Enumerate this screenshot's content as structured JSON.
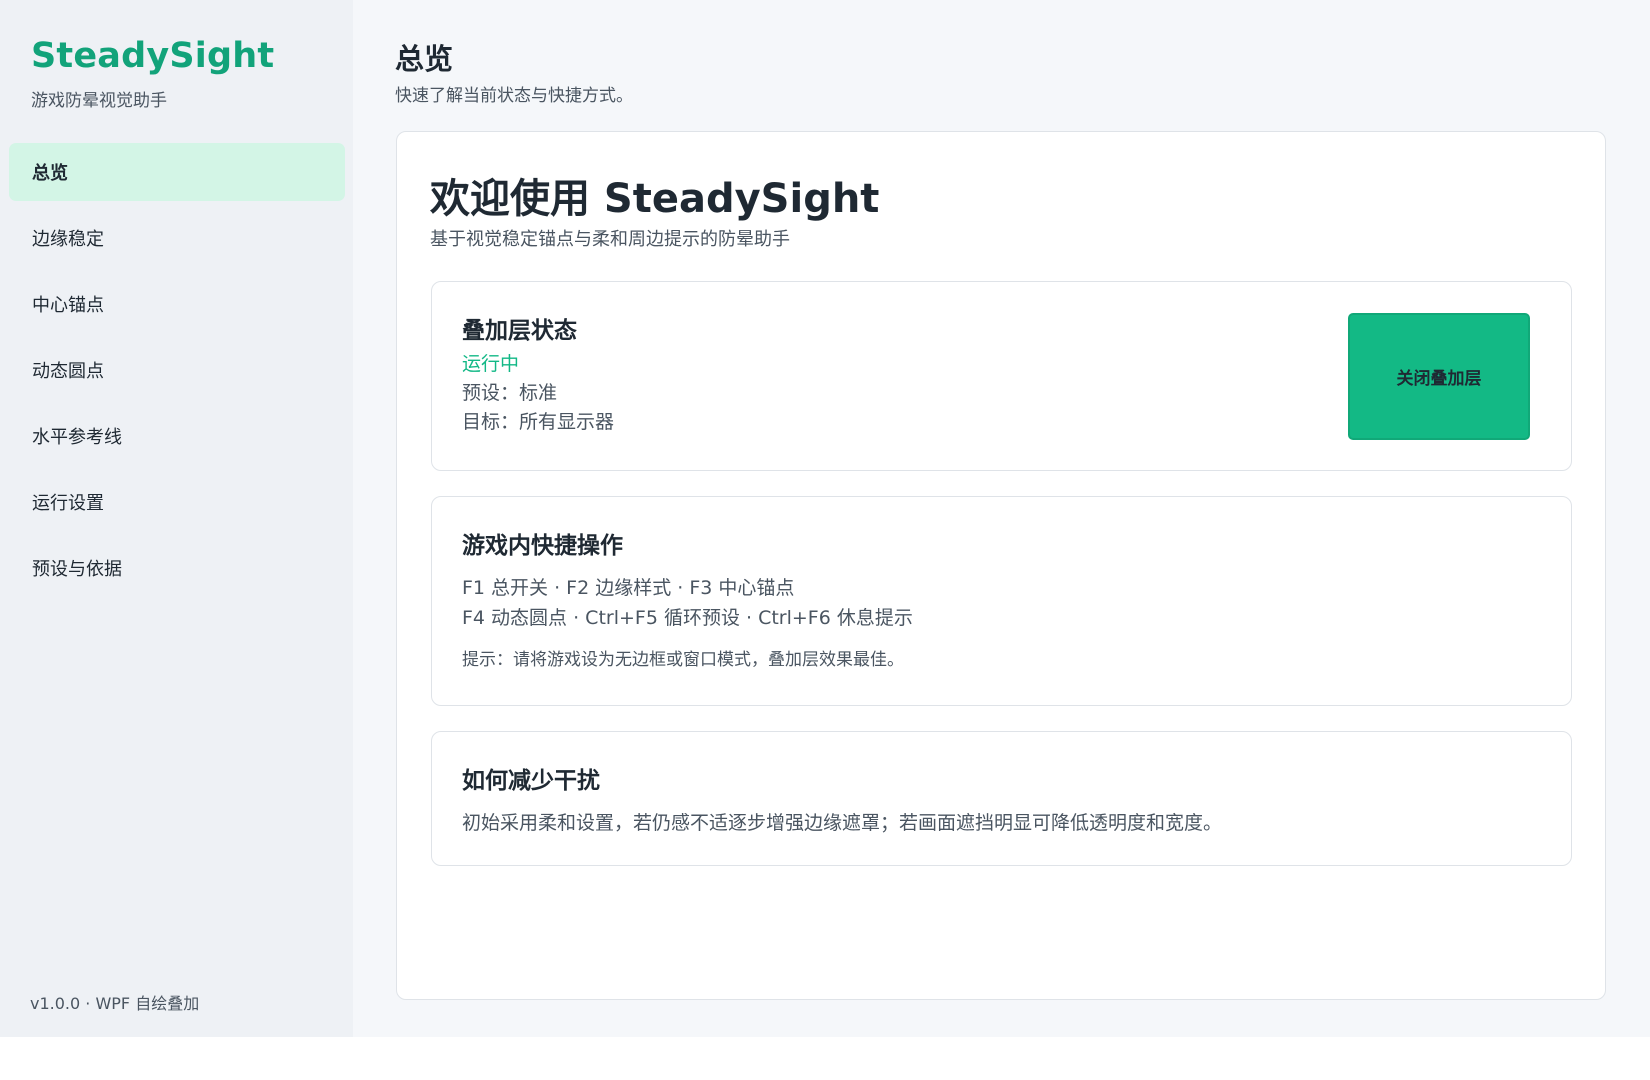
{
  "sidebar": {
    "brand_title": "SteadySight",
    "brand_subtitle": "游戏防晕视觉助手",
    "items": [
      {
        "label": "总览",
        "active": true
      },
      {
        "label": "边缘稳定",
        "active": false
      },
      {
        "label": "中心锚点",
        "active": false
      },
      {
        "label": "动态圆点",
        "active": false
      },
      {
        "label": "水平参考线",
        "active": false
      },
      {
        "label": "运行设置",
        "active": false
      },
      {
        "label": "预设与依据",
        "active": false
      }
    ],
    "version": "v1.0.0 · WPF 自绘叠加"
  },
  "header": {
    "title": "总览",
    "subtitle": "快速了解当前状态与快捷方式。"
  },
  "welcome": {
    "title": "欢迎使用 SteadySight",
    "subtitle": "基于视觉稳定锚点与柔和周边提示的防晕助手"
  },
  "status_panel": {
    "title": "叠加层状态",
    "state": "运行中",
    "preset": "预设：标准",
    "target": "目标：所有显示器",
    "button_label": "关闭叠加层"
  },
  "shortcuts_panel": {
    "title": "游戏内快捷操作",
    "line1": "F1  总开关 · F2  边缘样式 · F3  中心锚点",
    "line2": "F4  动态圆点 · Ctrl+F5  循环预设 · Ctrl+F6  休息提示",
    "hint": "提示：请将游戏设为无边框或窗口模式，叠加层效果最佳。"
  },
  "tips_panel": {
    "title": "如何减少干扰",
    "text": "初始采用柔和设置，若仍感不适逐步增强边缘遮罩；若画面遮挡明显可降低透明度和宽度。"
  },
  "colors": {
    "accent": "#12a37a",
    "running": "#12b886",
    "button": "#13b985",
    "nav_active": "#d3f5e6"
  }
}
